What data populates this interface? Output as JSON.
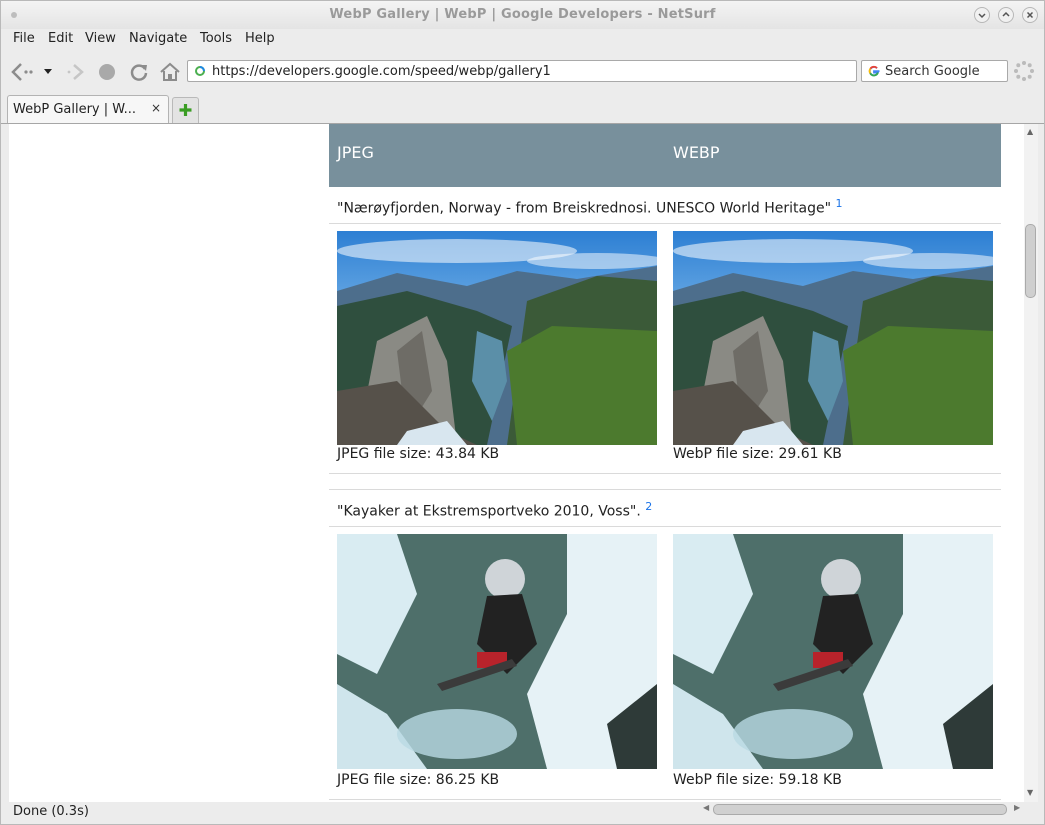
{
  "window": {
    "title": "WebP Gallery  |  WebP  |  Google Developers - NetSurf"
  },
  "menu": [
    "File",
    "Edit",
    "View",
    "Navigate",
    "Tools",
    "Help"
  ],
  "toolbar": {
    "url": "https://developers.google.com/speed/webp/gallery1",
    "search_placeholder": "Search Google"
  },
  "tabs": [
    {
      "label": "WebP Gallery  |  W...",
      "close": "×"
    }
  ],
  "new_tab": "+",
  "gallery": {
    "header": {
      "col1": "JPEG",
      "col2": "WEBP"
    },
    "items": [
      {
        "caption": "\"Nærøyfjorden, Norway - from Breiskrednosi. UNESCO World Heritage\"",
        "ref": "1",
        "jpeg_size": "JPEG file size: 43.84 KB",
        "webp_size": "WebP file size: 29.61 KB",
        "image": "fjord-landscape"
      },
      {
        "caption": "\"Kayaker at Ekstremsportveko 2010, Voss\".",
        "ref": "2",
        "jpeg_size": "JPEG file size: 86.25 KB",
        "webp_size": "WebP file size: 59.18 KB",
        "image": "kayaker-waterfall"
      }
    ]
  },
  "status": {
    "text": "Done (0.3s)"
  },
  "colors": {
    "gallery_header": "#78909c",
    "link": "#1a73e8"
  }
}
